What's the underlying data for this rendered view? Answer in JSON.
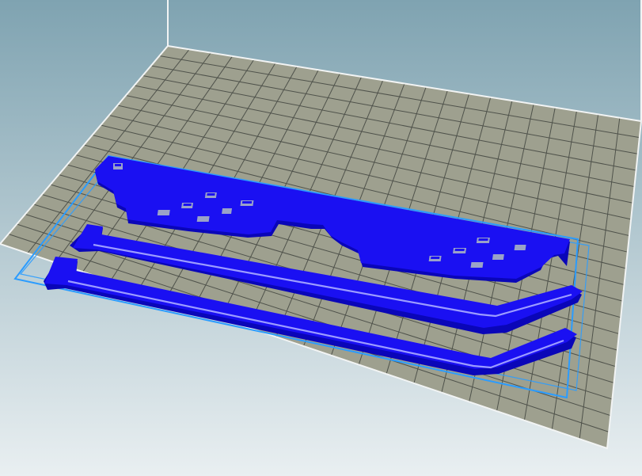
{
  "scene": {
    "background_top": "#7fa3b1",
    "background_bottom": "#e9eff1",
    "bed_color": "#9ea08f",
    "grid_line_color": "#4f524b",
    "wall_line_color": "#f2f4f4",
    "object_color": "#1a10f2",
    "object_shade_color": "#0a06b8",
    "object_highlight_color": "#9c9cff",
    "selection_box_color": "#2b9cff"
  },
  "objects": [
    {
      "name": "pixel-sunglasses-frame",
      "icon": "sunglasses-frame"
    },
    {
      "name": "sunglasses-temple-arm-1",
      "icon": "temple-arm"
    },
    {
      "name": "sunglasses-temple-arm-2",
      "icon": "temple-arm"
    }
  ]
}
